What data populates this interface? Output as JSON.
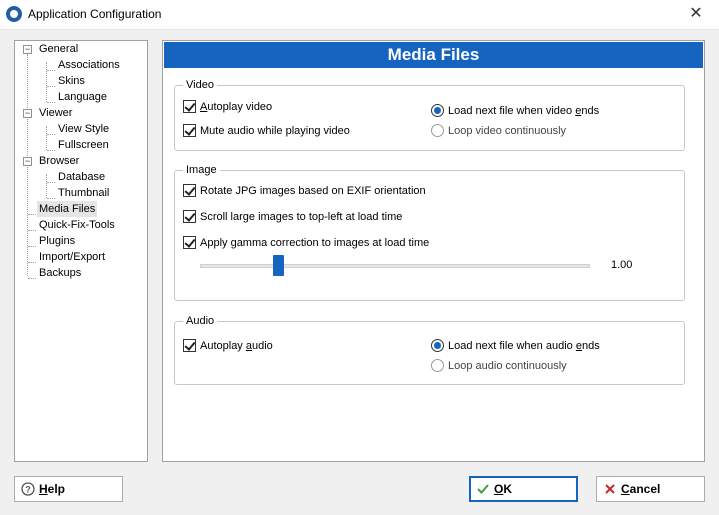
{
  "window": {
    "title": "Application Configuration",
    "close_glyph": "✕"
  },
  "tree": {
    "general": "General",
    "associations": "Associations",
    "skins": "Skins",
    "language": "Language",
    "viewer": "Viewer",
    "view_style": "View Style",
    "fullscreen": "Fullscreen",
    "browser": "Browser",
    "database": "Database",
    "thumbnail": "Thumbnail",
    "media_files": "Media Files",
    "quick_fix_tools": "Quick-Fix-Tools",
    "plugins": "Plugins",
    "import_export": "Import/Export",
    "backups": "Backups",
    "collapse_glyph": "−"
  },
  "panel": {
    "title": "Media Files",
    "video": {
      "label": "Video",
      "autoplay_pre": "",
      "autoplay_ul": "A",
      "autoplay_post": "utoplay video",
      "autoplay_checked": true,
      "mute": "Mute audio while playing video",
      "mute_checked": true,
      "load_next_pre": "Load next file when video ",
      "load_next_ul": "e",
      "load_next_post": "nds",
      "loop": "Loop video continuously",
      "selected": "load_next"
    },
    "image": {
      "label": "Image",
      "rotate": "Rotate JPG images based on EXIF orientation",
      "scroll": "Scroll large images to top-left at load time",
      "gamma": "Apply gamma correction to images at load time",
      "gamma_value": "1.00",
      "gamma_fraction": 0.2
    },
    "audio": {
      "label": "Audio",
      "autoplay_pre": "Autoplay ",
      "autoplay_ul": "a",
      "autoplay_post": "udio",
      "autoplay_checked": true,
      "load_next_pre": "Load next file when audio ",
      "load_next_ul": "e",
      "load_next_post": "nds",
      "loop": "Loop audio continuously",
      "selected": "load_next"
    }
  },
  "buttons": {
    "help_ul": "H",
    "help_post": "elp",
    "ok_ul": "O",
    "ok_post": "K",
    "cancel_ul": "C",
    "cancel_post": "ancel"
  },
  "colors": {
    "accent": "#1565c0",
    "ok_icon": "#3aa43a",
    "cancel_icon": "#c62828"
  }
}
